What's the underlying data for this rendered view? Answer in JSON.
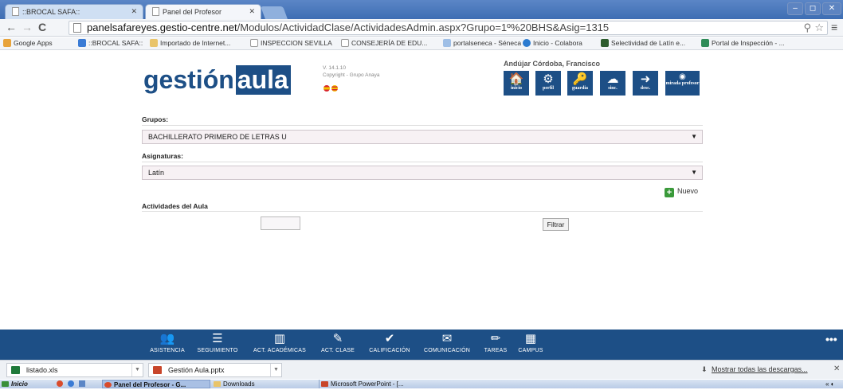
{
  "browser": {
    "tabs": [
      {
        "label": "::BROCAL SAFA::",
        "active": false
      },
      {
        "label": "Panel del Profesor",
        "active": true
      }
    ],
    "url_host": "panelsafareyes.gestio-centre.net",
    "url_path": "/Modulos/ActividadClase/ActividadesAdmin.aspx?Grupo=1º%20BHS&Asig=1315",
    "bookmarks": [
      {
        "label": "Google Apps",
        "color": "#e8a33a"
      },
      {
        "label": "::BROCAL SAFA::",
        "color": "#3a7bd5"
      },
      {
        "label": "Importado de Internet...",
        "color": "#e9c46a"
      },
      {
        "label": "INSPECCION SEVILLA",
        "color": "#cccccc"
      },
      {
        "label": "CONSEJERÍA DE EDU...",
        "color": "#cccccc"
      },
      {
        "label": "portalseneca - Séneca",
        "color": "#9fbfe6"
      },
      {
        "label": "Inicio - Colabora",
        "color": "#2b7bd0"
      },
      {
        "label": "Selectividad de Latín e...",
        "color": "#2d5c2d"
      },
      {
        "label": "Portal de Inspección - ...",
        "color": "#2e8b57"
      }
    ]
  },
  "app": {
    "logo_left": "gestión",
    "logo_right": "aula",
    "version": "V. 14.1.10",
    "copyright": "Copyright - Grupo Anaya",
    "user_name": "Andújar Córdoba, Francisco",
    "brand_color": "#1d4f86",
    "toolbar": [
      {
        "label": "inicio",
        "icon": "home-icon",
        "glyph": "🏠"
      },
      {
        "label": "perfil",
        "icon": "gears-icon",
        "glyph": "⚙"
      },
      {
        "label": "guardia",
        "icon": "key-icon",
        "glyph": "🔑"
      },
      {
        "label": "sinc.",
        "icon": "cloud-upload-icon",
        "glyph": "☁"
      },
      {
        "label": "desc.",
        "icon": "logout-icon",
        "glyph": "➜"
      },
      {
        "label": "mirada profesor",
        "icon": "eye-icon",
        "glyph": "◉"
      }
    ]
  },
  "form": {
    "grupos_label": "Grupos:",
    "grupos_value": "BACHILLERATO PRIMERO DE LETRAS U",
    "asignaturas_label": "Asignaturas:",
    "asignaturas_value": "Latín",
    "nuevo_label": "Nuevo",
    "actividades_label": "Actividades del Aula",
    "date_value": "",
    "filtrar_label": "Filtrar"
  },
  "bottom_nav": [
    {
      "label": "ASISTENCIA",
      "icon": "people-icon",
      "glyph": "👥"
    },
    {
      "label": "SEGUIMIENTO",
      "icon": "list-icon",
      "glyph": "☰"
    },
    {
      "label": "ACT. ACADÉMICAS",
      "icon": "bar-chart-icon",
      "glyph": "▥"
    },
    {
      "label": "ACT. CLASE",
      "icon": "edit-icon",
      "glyph": "✎"
    },
    {
      "label": "CALIFICACIÓN",
      "icon": "check-circle-icon",
      "glyph": "✔"
    },
    {
      "label": "COMUNICACIÓN",
      "icon": "mail-icon",
      "glyph": "✉"
    },
    {
      "label": "TAREAS",
      "icon": "pencil-icon",
      "glyph": "✏"
    },
    {
      "label": "CAMPUS",
      "icon": "building-icon",
      "glyph": "▦"
    }
  ],
  "downloads": [
    {
      "label": "listado.xls",
      "color": "#1f7a3a"
    },
    {
      "label": "Gestión Aula.pptx",
      "color": "#c8452a"
    }
  ],
  "show_all_downloads": "Mostrar todas las descargas...",
  "taskbar": [
    {
      "label": "Inicio",
      "color": "#3a8f3a"
    },
    {
      "label": "Panel del Profesor - G...",
      "color": "#d94b2b"
    },
    {
      "label": "Downloads",
      "color": "#e9c46a"
    },
    {
      "label": "Microsoft PowerPoint - [...",
      "color": "#c8452a"
    }
  ]
}
